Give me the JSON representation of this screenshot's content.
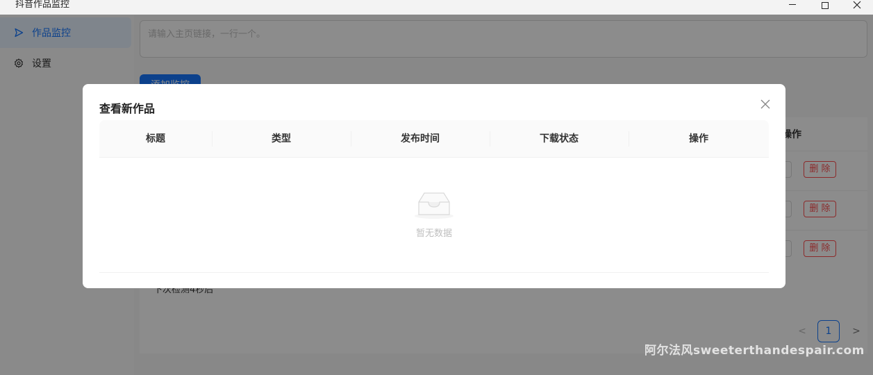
{
  "window": {
    "title": "抖音作品监控"
  },
  "sidebar": {
    "items": [
      {
        "label": "作品监控",
        "icon": "send-icon",
        "active": true
      },
      {
        "label": "设置",
        "icon": "gear-icon",
        "active": false
      }
    ]
  },
  "main": {
    "input_placeholder": "请输入主页链接，一行一个。",
    "add_button_label": "添加监控",
    "table_op_header": "操作",
    "rows": [
      {
        "delete_label": "删 除"
      },
      {
        "delete_label": "删 除"
      },
      {
        "delete_label": "删 除"
      }
    ],
    "next_check_text": "下次检测4秒后",
    "pagination": {
      "prev": "<",
      "current_page": "1",
      "next": ">"
    }
  },
  "modal": {
    "title": "查看新作品",
    "columns": [
      "标题",
      "类型",
      "发布时间",
      "下载状态",
      "操作"
    ],
    "empty_text": "暂无数据"
  },
  "watermark": "阿尔法风sweeterthandespair.com",
  "colors": {
    "primary": "#1677ff",
    "danger": "#ff4d4f",
    "mask": "rgba(0,0,0,0.45)"
  }
}
